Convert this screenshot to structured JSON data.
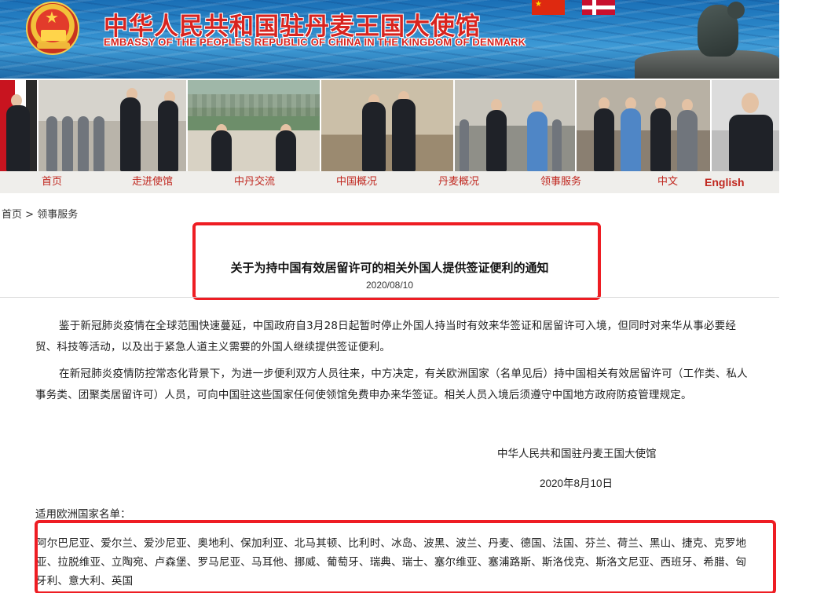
{
  "banner": {
    "title_cn": "中华人民共和国驻丹麦王国大使馆",
    "title_en": "EMBASSY OF THE PEOPLE'S REPUBLIC OF CHINA IN THE KINGDOM OF DENMARK"
  },
  "nav": {
    "items": [
      {
        "label": "首页"
      },
      {
        "label": "走进使馆"
      },
      {
        "label": "中丹交流"
      },
      {
        "label": "中国概况"
      },
      {
        "label": "丹麦概况"
      },
      {
        "label": "领事服务"
      },
      {
        "label": "中文"
      },
      {
        "label": "English"
      }
    ]
  },
  "breadcrumb": {
    "home": "首页",
    "separator": " > ",
    "current": "领事服务"
  },
  "article": {
    "title": "关于为持中国有效居留许可的相关外国人提供签证便利的通知",
    "date": "2020/08/10",
    "paragraph1": "鉴于新冠肺炎疫情在全球范围快速蔓延，中国政府自3月28日起暂时停止外国人持当时有效来华签证和居留许可入境，但同时对来华从事必要经贸、科技等活动，以及出于紧急人道主义需要的外国人继续提供签证便利。",
    "paragraph2": "在新冠肺炎疫情防控常态化背景下，为进一步便利双方人员往来，中方决定，有关欧洲国家（名单见后）持中国相关有效居留许可（工作类、私人事务类、团聚类居留许可）人员，可向中国驻这些国家任何使领馆免费申办来华签证。相关人员入境后须遵守中国地方政府防疫管理规定。",
    "signature_org": "中华人民共和国驻丹麦王国大使馆",
    "signature_date": "2020年8月10日",
    "list_label": "适用欧洲国家名单：",
    "countries": "阿尔巴尼亚、爱尔兰、爱沙尼亚、奥地利、保加利亚、北马其顿、比利时、冰岛、波黑、波兰、丹麦、德国、法国、芬兰、荷兰、黑山、捷克、克罗地亚、拉脱维亚、立陶宛、卢森堡、罗马尼亚、马耳他、挪威、葡萄牙、瑞典、瑞士、塞尔维亚、塞浦路斯、斯洛伐克、斯洛文尼亚、西班牙、希腊、匈牙利、意大利、英国"
  },
  "colors": {
    "accent_red": "#c0271f",
    "highlight_red": "#ee1d23",
    "nav_bg": "#efeeeb"
  },
  "icons": {
    "emblem": "national-emblem-icon",
    "flag_cn": "china-flag-icon",
    "flag_dk": "denmark-flag-icon"
  }
}
